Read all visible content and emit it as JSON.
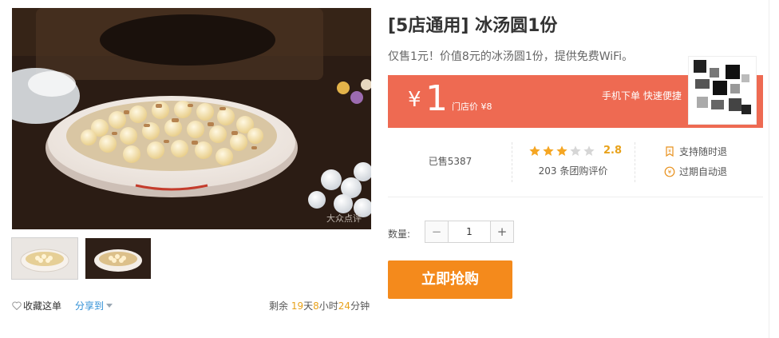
{
  "product": {
    "title": "[5店通用] 冰汤圆1份",
    "subtitle": "仅售1元！价值8元的冰汤圆1份，提供免费WiFi。",
    "watermark": "大众点评"
  },
  "price": {
    "currency": "¥",
    "value": "1",
    "store_price": "门店价 ¥8",
    "mobile_note": "手机下单 快速便捷"
  },
  "stats": {
    "sold": "已售5387",
    "rating": {
      "score": "2.8",
      "stars_filled": 3,
      "stars_total": 5,
      "review_count": "203 条团购评价"
    },
    "services": [
      {
        "icon": "refund-icon",
        "label": "支持随时退"
      },
      {
        "icon": "auto-refund-icon",
        "label": "过期自动退"
      }
    ]
  },
  "quantity": {
    "label": "数量:",
    "value": "1",
    "minus": "−",
    "plus": "+"
  },
  "buy_button": "立即抢购",
  "actions": {
    "favorite": "收藏这单",
    "share": "分享到"
  },
  "countdown": {
    "prefix": "剩余",
    "days": "19",
    "days_unit": "天",
    "hours": "8",
    "hours_unit": "小时",
    "minutes": "24",
    "minutes_unit": "分钟"
  },
  "colors": {
    "price_band": "#ee6a52",
    "buy_button": "#f48a1c",
    "star": "#f5a623",
    "share_link": "#2f8fd6"
  }
}
